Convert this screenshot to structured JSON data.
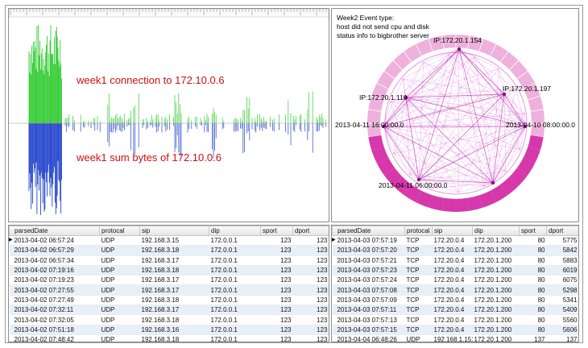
{
  "timeline": {
    "connection_label": "week1 connection to 172.10.0.6",
    "bytes_label": "week1 sum bytes  of  172.10.0.6",
    "label_color": "#cc1111",
    "connection_color": "#33cc33",
    "bytes_color": "#2244cc"
  },
  "radial": {
    "title_lines": [
      "Week2 Event type:",
      "host did not send cpu and disk",
      "status info to bigbrother server"
    ],
    "node_labels": {
      "top": "IP:172.20.1.154",
      "left": "IP:172.20.1.110",
      "right": "IP:172.20.1.197",
      "date_left": "2013-04-11 16:00:00.0",
      "date_right": "2013-04-10 08:00:00.0",
      "date_bottom": "2013-04-11 06:00:00.0"
    },
    "link_color": "#cc33cc",
    "ring_color": "#e070c0"
  },
  "table_left": {
    "columns": [
      "parsedDate",
      "protocal",
      "sip",
      "dip",
      "sport",
      "dport"
    ],
    "rows": [
      [
        "2013-04-02 06:57:24",
        "UDP",
        "192.168.3.15",
        "172.0.0.1",
        "123",
        "123"
      ],
      [
        "2013-04-02 06:57:29",
        "UDP",
        "192.168.3.18",
        "172.0.0.1",
        "123",
        "123"
      ],
      [
        "2013-04-02 06:57:34",
        "UDP",
        "192.168.3.17",
        "172.0.0.1",
        "123",
        "123"
      ],
      [
        "2013-04-02 07:19:16",
        "UDP",
        "192.168.3.18",
        "172.0.0.1",
        "123",
        "123"
      ],
      [
        "2013-04-02 07:19:23",
        "UDP",
        "192.168.3.17",
        "172.0.0.1",
        "123",
        "123"
      ],
      [
        "2013-04-02 07:27:55",
        "UDP",
        "192.168.3.17",
        "172.0.0.1",
        "123",
        "123"
      ],
      [
        "2013-04-02 07:27:49",
        "UDP",
        "192.168.3.18",
        "172.0.0.1",
        "123",
        "123"
      ],
      [
        "2013-04-02 07:32:11",
        "UDP",
        "192.168.3.17",
        "172.0.0.1",
        "123",
        "123"
      ],
      [
        "2013-04-02 07:32:05",
        "UDP",
        "192.168.3.18",
        "172.0.0.1",
        "123",
        "123"
      ],
      [
        "2013-04-02 07:51:18",
        "UDP",
        "192.168.3.16",
        "172.0.0.1",
        "123",
        "123"
      ],
      [
        "2013-04-02 07:48:42",
        "UDP",
        "192.168.3.18",
        "172.0.0.1",
        "123",
        "123"
      ]
    ]
  },
  "table_right": {
    "columns": [
      "parsedDate",
      "protocal",
      "sip",
      "dip",
      "sport",
      "dport"
    ],
    "rows": [
      [
        "2013-04-03 07:57:19",
        "TCP",
        "172.20.0.4",
        "172.20.1.200",
        "80",
        "5775"
      ],
      [
        "2013-04-03 07:57:20",
        "TCP",
        "172.20.0.4",
        "172.20.1.200",
        "80",
        "5842"
      ],
      [
        "2013-04-03 07:57:21",
        "TCP",
        "172.20.0.4",
        "172.20.1.200",
        "80",
        "5883"
      ],
      [
        "2013-04-03 07:57:23",
        "TCP",
        "172.20.0.4",
        "172.20.1.200",
        "80",
        "6019"
      ],
      [
        "2013-04-03 07:57:24",
        "TCP",
        "172.20.0.4",
        "172.20.1.200",
        "80",
        "6075"
      ],
      [
        "2013-04-03 07:57:08",
        "TCP",
        "172.20.0.4",
        "172.20.1.200",
        "80",
        "5298"
      ],
      [
        "2013-04-03 07:57:09",
        "TCP",
        "172.20.0.4",
        "172.20.1.200",
        "80",
        "5341"
      ],
      [
        "2013-04-03 07:57:11",
        "TCP",
        "172.20.0.4",
        "172.20.1.200",
        "80",
        "5409"
      ],
      [
        "2013-04-03 07:57:13",
        "TCP",
        "172.20.0.4",
        "172.20.1.200",
        "80",
        "5560"
      ],
      [
        "2013-04-03 07:57:15",
        "TCP",
        "172.20.0.4",
        "172.20.1.200",
        "80",
        "5606"
      ],
      [
        "2013-04-04 06:48:26",
        "UDP",
        "192.168.1.151",
        "172.20.1.200",
        "137",
        "137"
      ]
    ]
  }
}
